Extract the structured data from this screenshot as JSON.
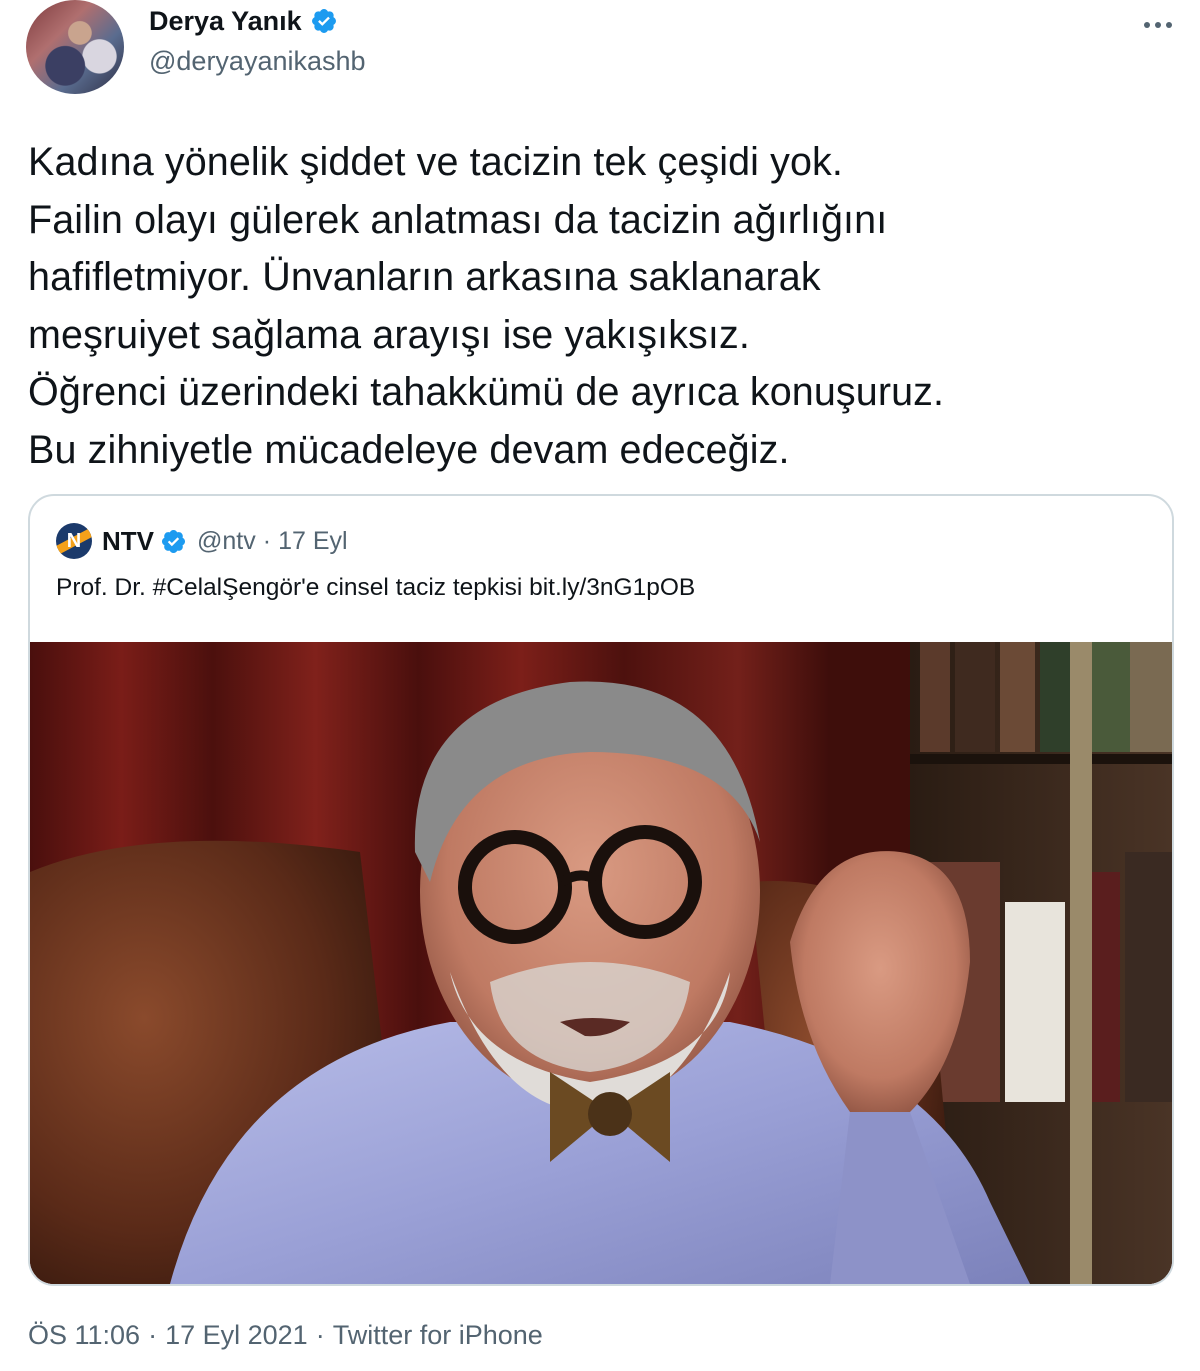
{
  "tweet": {
    "author": {
      "name": "Derya Yanık",
      "handle": "@deryayanikashb",
      "verified": true
    },
    "menu_icon": "more-horizontal-icon",
    "text_lines": [
      "Kadına yönelik şiddet ve tacizin tek çeşidi yok.",
      "Failin olayı gülerek anlatması da tacizin ağırlığını",
      "hafifletmiyor. Ünvanların arkasına saklanarak",
      "meşruiyet sağlama arayışı ise yakışıksız.",
      "Öğrenci üzerindeki tahakkümü de ayrıca konuşuruz.",
      "Bu zihniyetle mücadeleye devam edeceğiz."
    ],
    "quoted": {
      "author": {
        "name": "NTV",
        "handle": "@ntv",
        "date": "17 Eyl",
        "verified": true,
        "logo_letter": "N"
      },
      "separator": "·",
      "text": "Prof. Dr. #CelalŞengör'e cinsel taciz tepkisi bit.ly/3nG1pOB",
      "media": "photo"
    },
    "footer": {
      "time": "ÖS 11:06",
      "date": "17 Eyl 2021",
      "source": "Twitter for iPhone",
      "separator": "·"
    }
  },
  "colors": {
    "text": "#0f1419",
    "secondary": "#536471",
    "verified": "#1d9bf0",
    "border": "#cfd9de"
  }
}
